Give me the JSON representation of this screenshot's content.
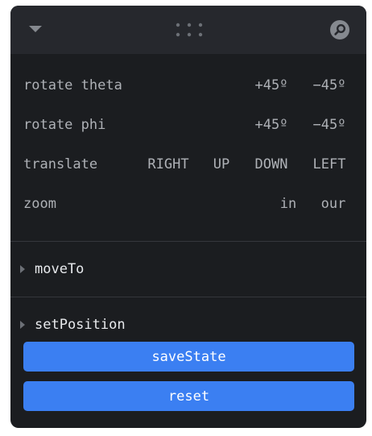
{
  "header": {
    "collapse_icon": "caret-down-icon",
    "drag_icon": "drag-handle-icon",
    "search_icon": "search-icon"
  },
  "controls": {
    "rotate_theta": {
      "label": "rotate theta",
      "plus": "+45º",
      "minus": "−45º"
    },
    "rotate_phi": {
      "label": "rotate phi",
      "plus": "+45º",
      "minus": "−45º"
    },
    "translate": {
      "label": "translate",
      "right": "RIGHT",
      "up": "UP",
      "down": "DOWN",
      "left": "LEFT"
    },
    "zoom": {
      "label": "zoom",
      "in": "in",
      "out": "our"
    }
  },
  "folders": {
    "move_to": "moveTo",
    "set_position": "setPosition"
  },
  "buttons": {
    "save_state": "saveState",
    "reset": "reset"
  },
  "colors": {
    "panel_bg": "#1b1d20",
    "header_bg": "#26282d",
    "accent": "#3b7ff2"
  }
}
